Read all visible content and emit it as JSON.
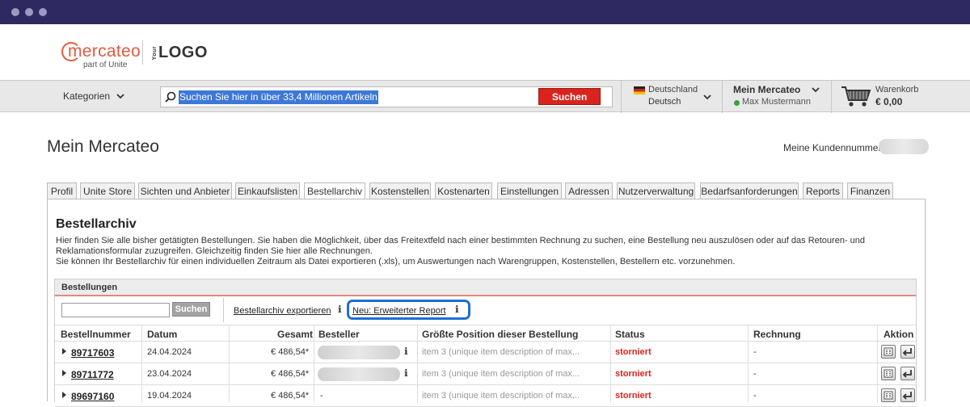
{
  "header": {
    "brand": "mercateo",
    "brand_sub": "part of Unite",
    "customer_logo_prefix": "Your",
    "customer_logo": "LOGO"
  },
  "navbar": {
    "categories_label": "Kategorien",
    "search_placeholder": "Suchen Sie hier in über 33,4 Millionen Artikeln",
    "search_button": "Suchen",
    "country": "Deutschland",
    "language": "Deutsch",
    "account_title": "Mein Mercateo",
    "account_user": "Max Mustermann",
    "cart_label": "Warenkorb",
    "cart_total": "€ 0,00"
  },
  "page": {
    "title": "Mein Mercateo",
    "customer_number_label": "Meine Kundennummer:"
  },
  "tabs": [
    "Profil",
    "Unite Store",
    "Sichten und Anbieter",
    "Einkaufslisten",
    "Bestellarchiv",
    "Kostenstellen",
    "Kostenarten",
    "Einstellungen",
    "Adressen",
    "Nutzerverwaltung",
    "Bedarfsanforderungen",
    "Reports",
    "Finanzen"
  ],
  "active_tab": "Bestellarchiv",
  "archive": {
    "title": "Bestellarchiv",
    "desc_line1": "Hier finden Sie alle bisher getätigten Bestellungen. Sie haben die Möglichkeit, über das Freitextfeld nach einer bestimmten Rechnung zu suchen, eine Bestellung neu auszulösen oder auf das Retouren- und",
    "desc_line2": "Reklamationsformular zuzugreifen. Gleichzeitig finden Sie hier alle Rechnungen.",
    "desc_line3": "Sie können Ihr Bestellarchiv für einen individuellen Zeitraum als Datei exportieren (.xls), um Auswertungen nach Warengruppen, Kostenstellen, Bestellern etc. vorzunehmen.",
    "orders_heading": "Bestellungen",
    "filter_button": "Suchen",
    "export_link": "Bestellarchiv exportieren",
    "report_link": "Neu: Erweiterter Report"
  },
  "table": {
    "columns": [
      "Bestellnummer",
      "Datum",
      "Gesamt",
      "Besteller",
      "Größte Position dieser Bestellung",
      "Status",
      "Rechnung",
      "Aktion"
    ],
    "rows": [
      {
        "number": "89717603",
        "date": "24.04.2024",
        "total": "€ 486,54*",
        "orderer": "",
        "item": "item 3 (unique item description of max...",
        "status": "storniert",
        "invoice": "-"
      },
      {
        "number": "89711772",
        "date": "23.04.2024",
        "total": "€ 486,54*",
        "orderer": "",
        "item": "item 3 (unique item description of max...",
        "status": "storniert",
        "invoice": "-"
      },
      {
        "number": "89697160",
        "date": "19.04.2024",
        "total": "€ 486,54*",
        "orderer": "-",
        "item": "item 3 (unique item description of max...",
        "status": "storniert",
        "invoice": "-"
      }
    ]
  },
  "colors": {
    "titlebar": "#2e2960",
    "brand": "#e35a3f",
    "search_button": "#d8241d",
    "status_cancelled": "#d8241d",
    "highlight": "#1d6fd8"
  }
}
